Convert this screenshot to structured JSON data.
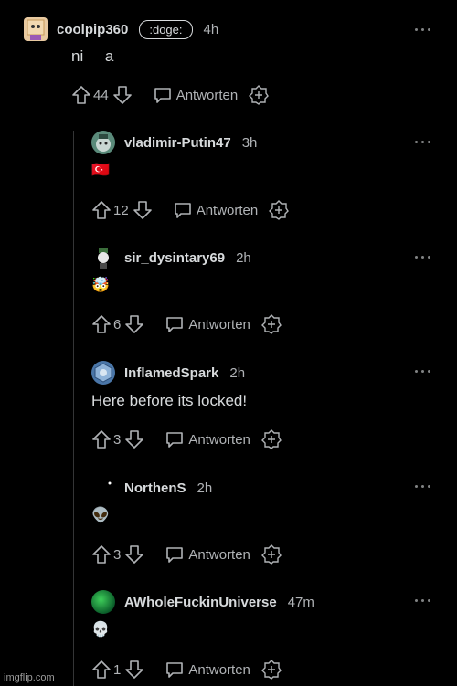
{
  "reply_label": "Antworten",
  "comments": [
    {
      "username": "coolpip360",
      "flair": ":doge:",
      "time": "4h",
      "text": "ni     a",
      "votes": "44"
    },
    {
      "username": "vladimir-Putin47",
      "time": "3h",
      "emoji": "🇹🇷",
      "votes": "12"
    },
    {
      "username": "sir_dysintary69",
      "time": "2h",
      "emoji": "🤯",
      "votes": "6"
    },
    {
      "username": "InflamedSpark",
      "time": "2h",
      "text": "Here before its locked!",
      "votes": "3"
    },
    {
      "username": "NorthenS",
      "time": "2h",
      "emoji": "👽",
      "votes": "3"
    },
    {
      "username": "AWholeFuckinUniverse",
      "time": "47m",
      "emoji": "💀",
      "votes": "1"
    }
  ],
  "watermark": "imgflip.com",
  "colors": {
    "background": "#000000",
    "text": "#d7dadc",
    "muted": "#b0b3b6",
    "thread_line": "#343536"
  }
}
